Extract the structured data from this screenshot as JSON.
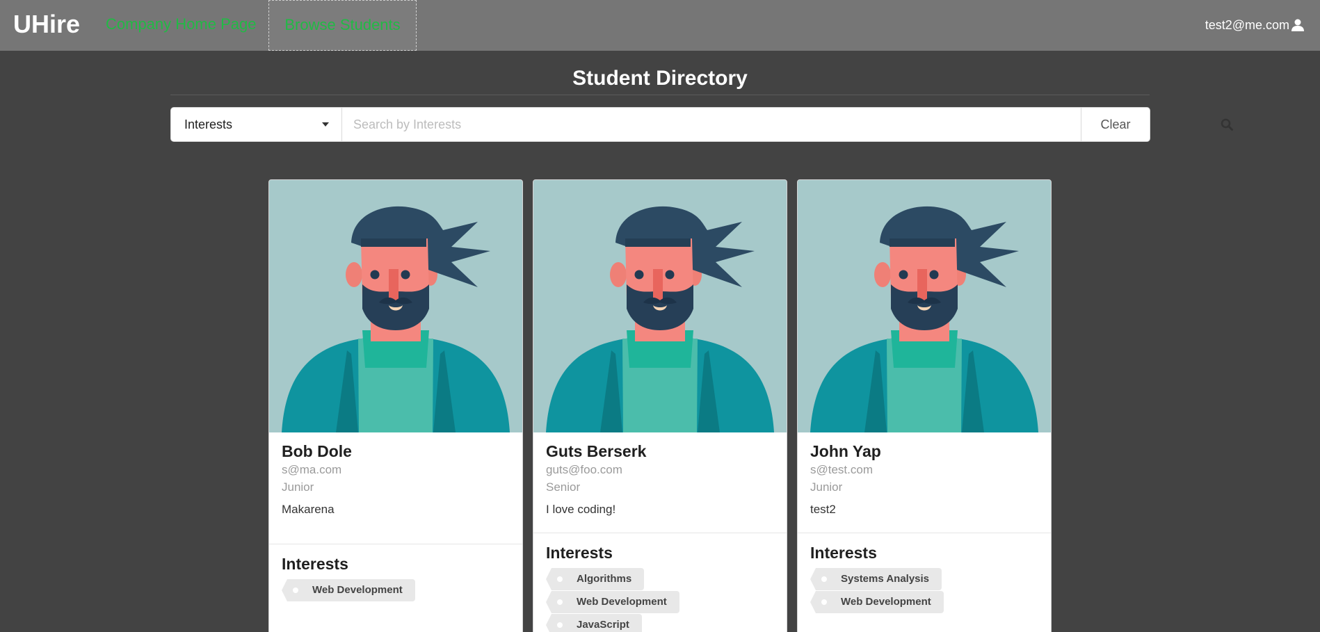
{
  "nav": {
    "brand": "UHire",
    "home_link": "Company Home Page",
    "browse_link": "Browse Students",
    "user_email": "test2@me.com",
    "user_icon": "user-icon",
    "link_color": "#21ba45"
  },
  "page": {
    "title": "Student Directory"
  },
  "search": {
    "filter_selected": "Interests",
    "placeholder": "Search by Interests",
    "value": "",
    "clear_label": "Clear",
    "search_icon": "search-icon"
  },
  "students": [
    {
      "name": "Bob Dole",
      "email": "s@ma.com",
      "year": "Junior",
      "description": "Makarena",
      "interests_title": "Interests",
      "interests": [
        "Web Development"
      ]
    },
    {
      "name": "Guts Berserk",
      "email": "guts@foo.com",
      "year": "Senior",
      "description": "I love coding!",
      "interests_title": "Interests",
      "interests": [
        "Algorithms",
        "Web Development",
        "JavaScript"
      ]
    },
    {
      "name": "John Yap",
      "email": "s@test.com",
      "year": "Junior",
      "description": "test2",
      "interests_title": "Interests",
      "interests": [
        "Systems Analysis",
        "Web Development"
      ]
    }
  ],
  "colors": {
    "background": "#434343",
    "navbar": "#767676",
    "avatar_background": "#a6c9ca"
  }
}
